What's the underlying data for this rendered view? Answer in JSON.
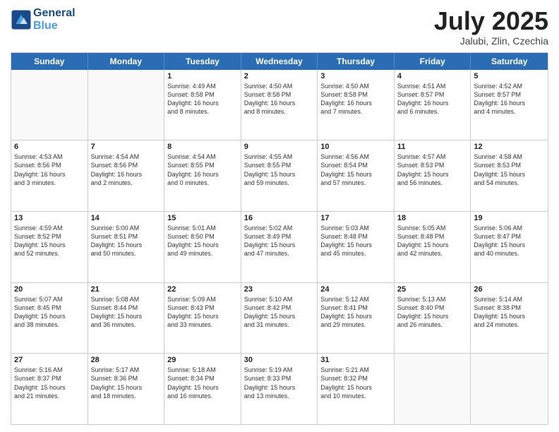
{
  "header": {
    "logo_line1": "General",
    "logo_line2": "Blue",
    "month": "July 2025",
    "location": "Jalubi, Zlin, Czechia"
  },
  "days_of_week": [
    "Sunday",
    "Monday",
    "Tuesday",
    "Wednesday",
    "Thursday",
    "Friday",
    "Saturday"
  ],
  "weeks": [
    [
      {
        "day": "",
        "info": ""
      },
      {
        "day": "",
        "info": ""
      },
      {
        "day": "1",
        "info": "Sunrise: 4:49 AM\nSunset: 8:58 PM\nDaylight: 16 hours\nand 8 minutes."
      },
      {
        "day": "2",
        "info": "Sunrise: 4:50 AM\nSunset: 8:58 PM\nDaylight: 16 hours\nand 8 minutes."
      },
      {
        "day": "3",
        "info": "Sunrise: 4:50 AM\nSunset: 8:58 PM\nDaylight: 16 hours\nand 7 minutes."
      },
      {
        "day": "4",
        "info": "Sunrise: 4:51 AM\nSunset: 8:57 PM\nDaylight: 16 hours\nand 6 minutes."
      },
      {
        "day": "5",
        "info": "Sunrise: 4:52 AM\nSunset: 8:57 PM\nDaylight: 16 hours\nand 4 minutes."
      }
    ],
    [
      {
        "day": "6",
        "info": "Sunrise: 4:53 AM\nSunset: 8:56 PM\nDaylight: 16 hours\nand 3 minutes."
      },
      {
        "day": "7",
        "info": "Sunrise: 4:54 AM\nSunset: 8:56 PM\nDaylight: 16 hours\nand 2 minutes."
      },
      {
        "day": "8",
        "info": "Sunrise: 4:54 AM\nSunset: 8:55 PM\nDaylight: 16 hours\nand 0 minutes."
      },
      {
        "day": "9",
        "info": "Sunrise: 4:55 AM\nSunset: 8:55 PM\nDaylight: 15 hours\nand 59 minutes."
      },
      {
        "day": "10",
        "info": "Sunrise: 4:56 AM\nSunset: 8:54 PM\nDaylight: 15 hours\nand 57 minutes."
      },
      {
        "day": "11",
        "info": "Sunrise: 4:57 AM\nSunset: 8:53 PM\nDaylight: 15 hours\nand 56 minutes."
      },
      {
        "day": "12",
        "info": "Sunrise: 4:58 AM\nSunset: 8:53 PM\nDaylight: 15 hours\nand 54 minutes."
      }
    ],
    [
      {
        "day": "13",
        "info": "Sunrise: 4:59 AM\nSunset: 8:52 PM\nDaylight: 15 hours\nand 52 minutes."
      },
      {
        "day": "14",
        "info": "Sunrise: 5:00 AM\nSunset: 8:51 PM\nDaylight: 15 hours\nand 50 minutes."
      },
      {
        "day": "15",
        "info": "Sunrise: 5:01 AM\nSunset: 8:50 PM\nDaylight: 15 hours\nand 49 minutes."
      },
      {
        "day": "16",
        "info": "Sunrise: 5:02 AM\nSunset: 8:49 PM\nDaylight: 15 hours\nand 47 minutes."
      },
      {
        "day": "17",
        "info": "Sunrise: 5:03 AM\nSunset: 8:48 PM\nDaylight: 15 hours\nand 45 minutes."
      },
      {
        "day": "18",
        "info": "Sunrise: 5:05 AM\nSunset: 8:48 PM\nDaylight: 15 hours\nand 42 minutes."
      },
      {
        "day": "19",
        "info": "Sunrise: 5:06 AM\nSunset: 8:47 PM\nDaylight: 15 hours\nand 40 minutes."
      }
    ],
    [
      {
        "day": "20",
        "info": "Sunrise: 5:07 AM\nSunset: 8:45 PM\nDaylight: 15 hours\nand 38 minutes."
      },
      {
        "day": "21",
        "info": "Sunrise: 5:08 AM\nSunset: 8:44 PM\nDaylight: 15 hours\nand 36 minutes."
      },
      {
        "day": "22",
        "info": "Sunrise: 5:09 AM\nSunset: 8:43 PM\nDaylight: 15 hours\nand 33 minutes."
      },
      {
        "day": "23",
        "info": "Sunrise: 5:10 AM\nSunset: 8:42 PM\nDaylight: 15 hours\nand 31 minutes."
      },
      {
        "day": "24",
        "info": "Sunrise: 5:12 AM\nSunset: 8:41 PM\nDaylight: 15 hours\nand 29 minutes."
      },
      {
        "day": "25",
        "info": "Sunrise: 5:13 AM\nSunset: 8:40 PM\nDaylight: 15 hours\nand 26 minutes."
      },
      {
        "day": "26",
        "info": "Sunrise: 5:14 AM\nSunset: 8:38 PM\nDaylight: 15 hours\nand 24 minutes."
      }
    ],
    [
      {
        "day": "27",
        "info": "Sunrise: 5:16 AM\nSunset: 8:37 PM\nDaylight: 15 hours\nand 21 minutes."
      },
      {
        "day": "28",
        "info": "Sunrise: 5:17 AM\nSunset: 8:36 PM\nDaylight: 15 hours\nand 18 minutes."
      },
      {
        "day": "29",
        "info": "Sunrise: 5:18 AM\nSunset: 8:34 PM\nDaylight: 15 hours\nand 16 minutes."
      },
      {
        "day": "30",
        "info": "Sunrise: 5:19 AM\nSunset: 8:33 PM\nDaylight: 15 hours\nand 13 minutes."
      },
      {
        "day": "31",
        "info": "Sunrise: 5:21 AM\nSunset: 8:32 PM\nDaylight: 15 hours\nand 10 minutes."
      },
      {
        "day": "",
        "info": ""
      },
      {
        "day": "",
        "info": ""
      }
    ]
  ]
}
